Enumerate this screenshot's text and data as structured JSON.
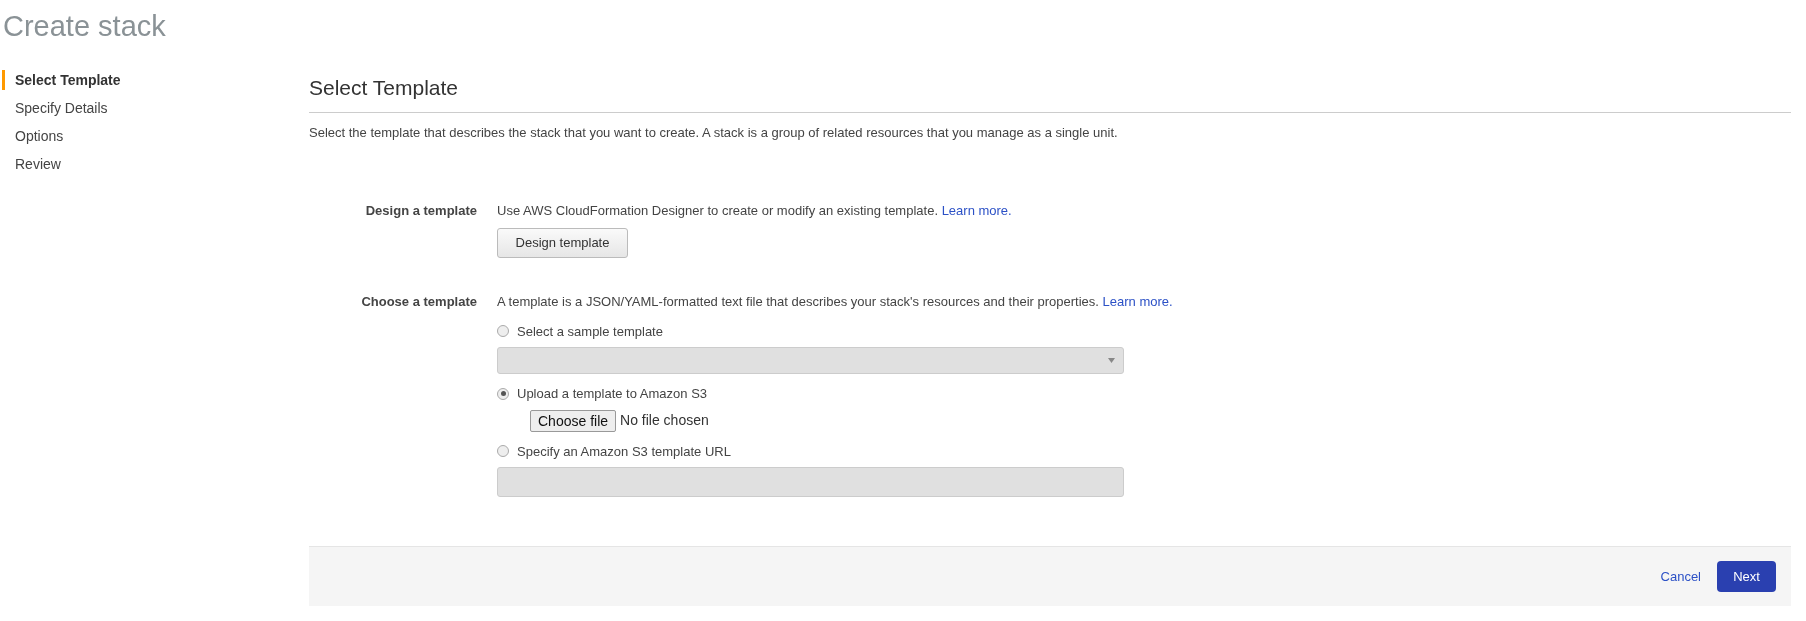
{
  "page_title": "Create stack",
  "steps": [
    {
      "label": "Select Template",
      "selected": true
    },
    {
      "label": "Specify Details",
      "selected": false
    },
    {
      "label": "Options",
      "selected": false
    },
    {
      "label": "Review",
      "selected": false
    }
  ],
  "section": {
    "title": "Select Template",
    "description": "Select the template that describes the stack that you want to create. A stack is a group of related resources that you manage as a single unit."
  },
  "design": {
    "label": "Design a template",
    "text": "Use AWS CloudFormation Designer to create or modify an existing template.",
    "link": "Learn more.",
    "button": "Design template"
  },
  "choose": {
    "label": "Choose a template",
    "text": "A template is a JSON/YAML-formatted text file that describes your stack's resources and their properties.",
    "link": "Learn more.",
    "options": [
      {
        "label": "Select a sample template",
        "selected": false,
        "control": {
          "kind": "select",
          "disabled": true
        }
      },
      {
        "label": "Upload a template to Amazon S3",
        "selected": true,
        "control": {
          "kind": "file",
          "button": "Choose file",
          "status": "No file chosen"
        }
      },
      {
        "label": "Specify an Amazon S3 template URL",
        "selected": false,
        "control": {
          "kind": "text",
          "disabled": true
        }
      }
    ]
  },
  "footer": {
    "cancel": "Cancel",
    "next": "Next"
  }
}
